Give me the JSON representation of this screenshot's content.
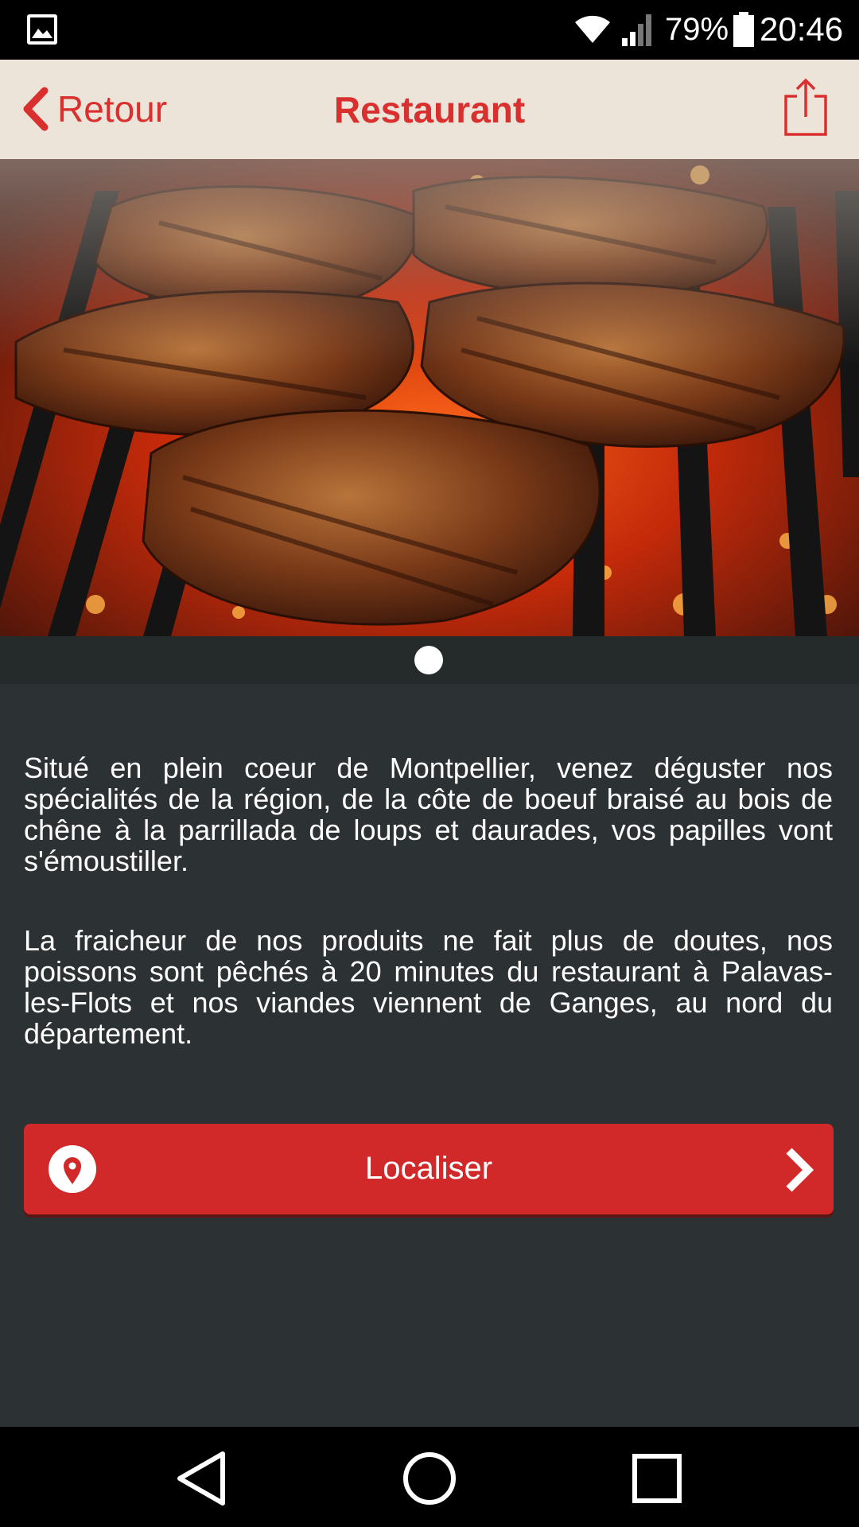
{
  "status_bar": {
    "battery_percent": "79%",
    "time": "20:46",
    "icons": [
      "gallery-icon",
      "wifi-icon",
      "signal-icon",
      "battery-icon"
    ]
  },
  "header": {
    "back_label": "Retour",
    "title": "Restaurant",
    "share_icon": "share-icon"
  },
  "hero": {
    "image_icon": "grilled-meat-photo",
    "page_count": 1,
    "current_page": 1
  },
  "description": {
    "paragraph_1": "Situé en plein coeur de Montpellier, venez déguster nos spécialités de la région, de la côte de boeuf braisé au bois de chêne à la parrillada de loups et daurades, vos papilles vont s'émoustiller.",
    "paragraph_2": "La fraicheur de nos produits ne fait plus de doutes, nos poissons sont pêchés à 20 minutes du restaurant à Palavas-les-Flots et nos viandes viennent de Ganges, au nord du département."
  },
  "locate": {
    "label": "Localiser",
    "icon": "map-pin-icon",
    "chevron": "chevron-right-icon"
  },
  "colors": {
    "accent": "#d9302f",
    "header_bg": "#ece4d9",
    "content_bg": "#2c3233",
    "button_bg": "#d1292a"
  },
  "nav_bar": {
    "icons": [
      "back-triangle-icon",
      "home-circle-icon",
      "recents-square-icon"
    ]
  }
}
